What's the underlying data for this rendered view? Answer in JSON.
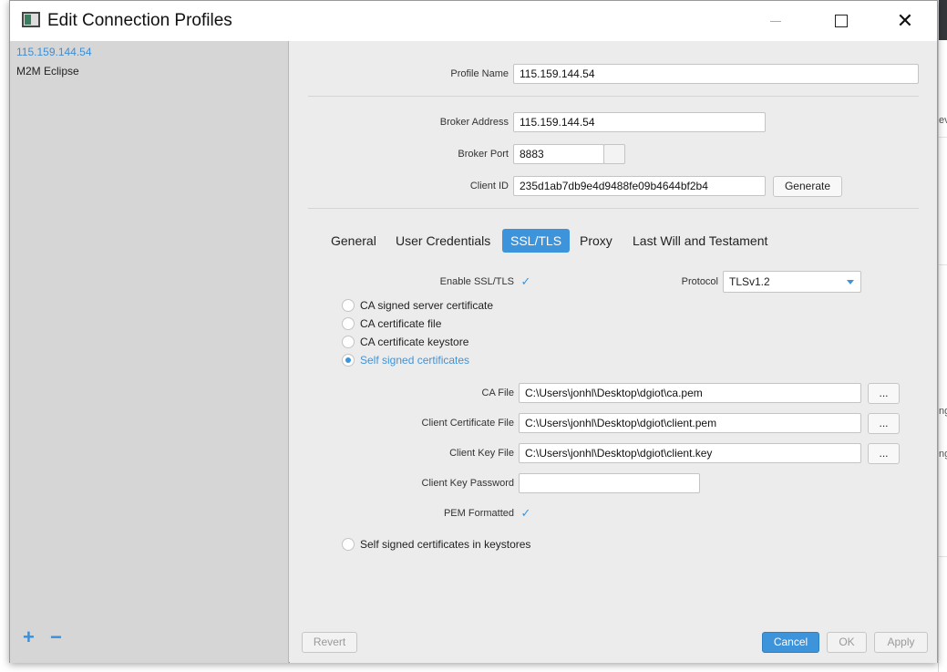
{
  "window": {
    "title": "Edit Connection Profiles",
    "minimize_icon": "minimize-icon",
    "maximize_icon": "maximize-icon",
    "close_icon": "close-icon",
    "close_glyph": "✕"
  },
  "sidebar": {
    "profiles": [
      "115.159.144.54",
      "M2M Eclipse"
    ],
    "add_glyph": "+",
    "remove_glyph": "−"
  },
  "form": {
    "profile_name_label": "Profile Name",
    "profile_name_value": "115.159.144.54",
    "broker_address_label": "Broker Address",
    "broker_address_value": "115.159.144.54",
    "broker_port_label": "Broker Port",
    "broker_port_value": "8883",
    "client_id_label": "Client ID",
    "client_id_value": "235d1ab7db9e4d9488fe09b4644bf2b4",
    "generate_label": "Generate"
  },
  "tabs": [
    "General",
    "User Credentials",
    "SSL/TLS",
    "Proxy",
    "Last Will and Testament"
  ],
  "active_tab": "SSL/TLS",
  "ssl": {
    "enable_label": "Enable SSL/TLS",
    "enable_checked": true,
    "protocol_label": "Protocol",
    "protocol_value": "TLSv1.2",
    "check_glyph": "✓",
    "radios": [
      {
        "label": "CA signed server certificate",
        "selected": false
      },
      {
        "label": "CA certificate file",
        "selected": false
      },
      {
        "label": "CA certificate keystore",
        "selected": false
      },
      {
        "label": "Self signed certificates",
        "selected": true
      }
    ],
    "ca_file_label": "CA File",
    "ca_file_value": "C:\\Users\\jonhl\\Desktop\\dgiot\\ca.pem",
    "client_cert_label": "Client Certificate File",
    "client_cert_value": "C:\\Users\\jonhl\\Desktop\\dgiot\\client.pem",
    "client_key_label": "Client Key File",
    "client_key_value": "C:\\Users\\jonhl\\Desktop\\dgiot\\client.key",
    "browse_label": "...",
    "client_key_password_label": "Client Key Password",
    "client_key_password_value": "",
    "pem_label": "PEM Formatted",
    "pem_checked": true,
    "keystore_radio_label": "Self signed certificates in keystores"
  },
  "footer": {
    "revert_label": "Revert",
    "cancel_label": "Cancel",
    "ok_label": "OK",
    "apply_label": "Apply"
  },
  "background_fragments": [
    "ev",
    "ng",
    "ng"
  ],
  "colors": {
    "accent": "#3d94db",
    "sidebar_bg": "#d6d6d6",
    "panel_bg": "#ececec"
  }
}
